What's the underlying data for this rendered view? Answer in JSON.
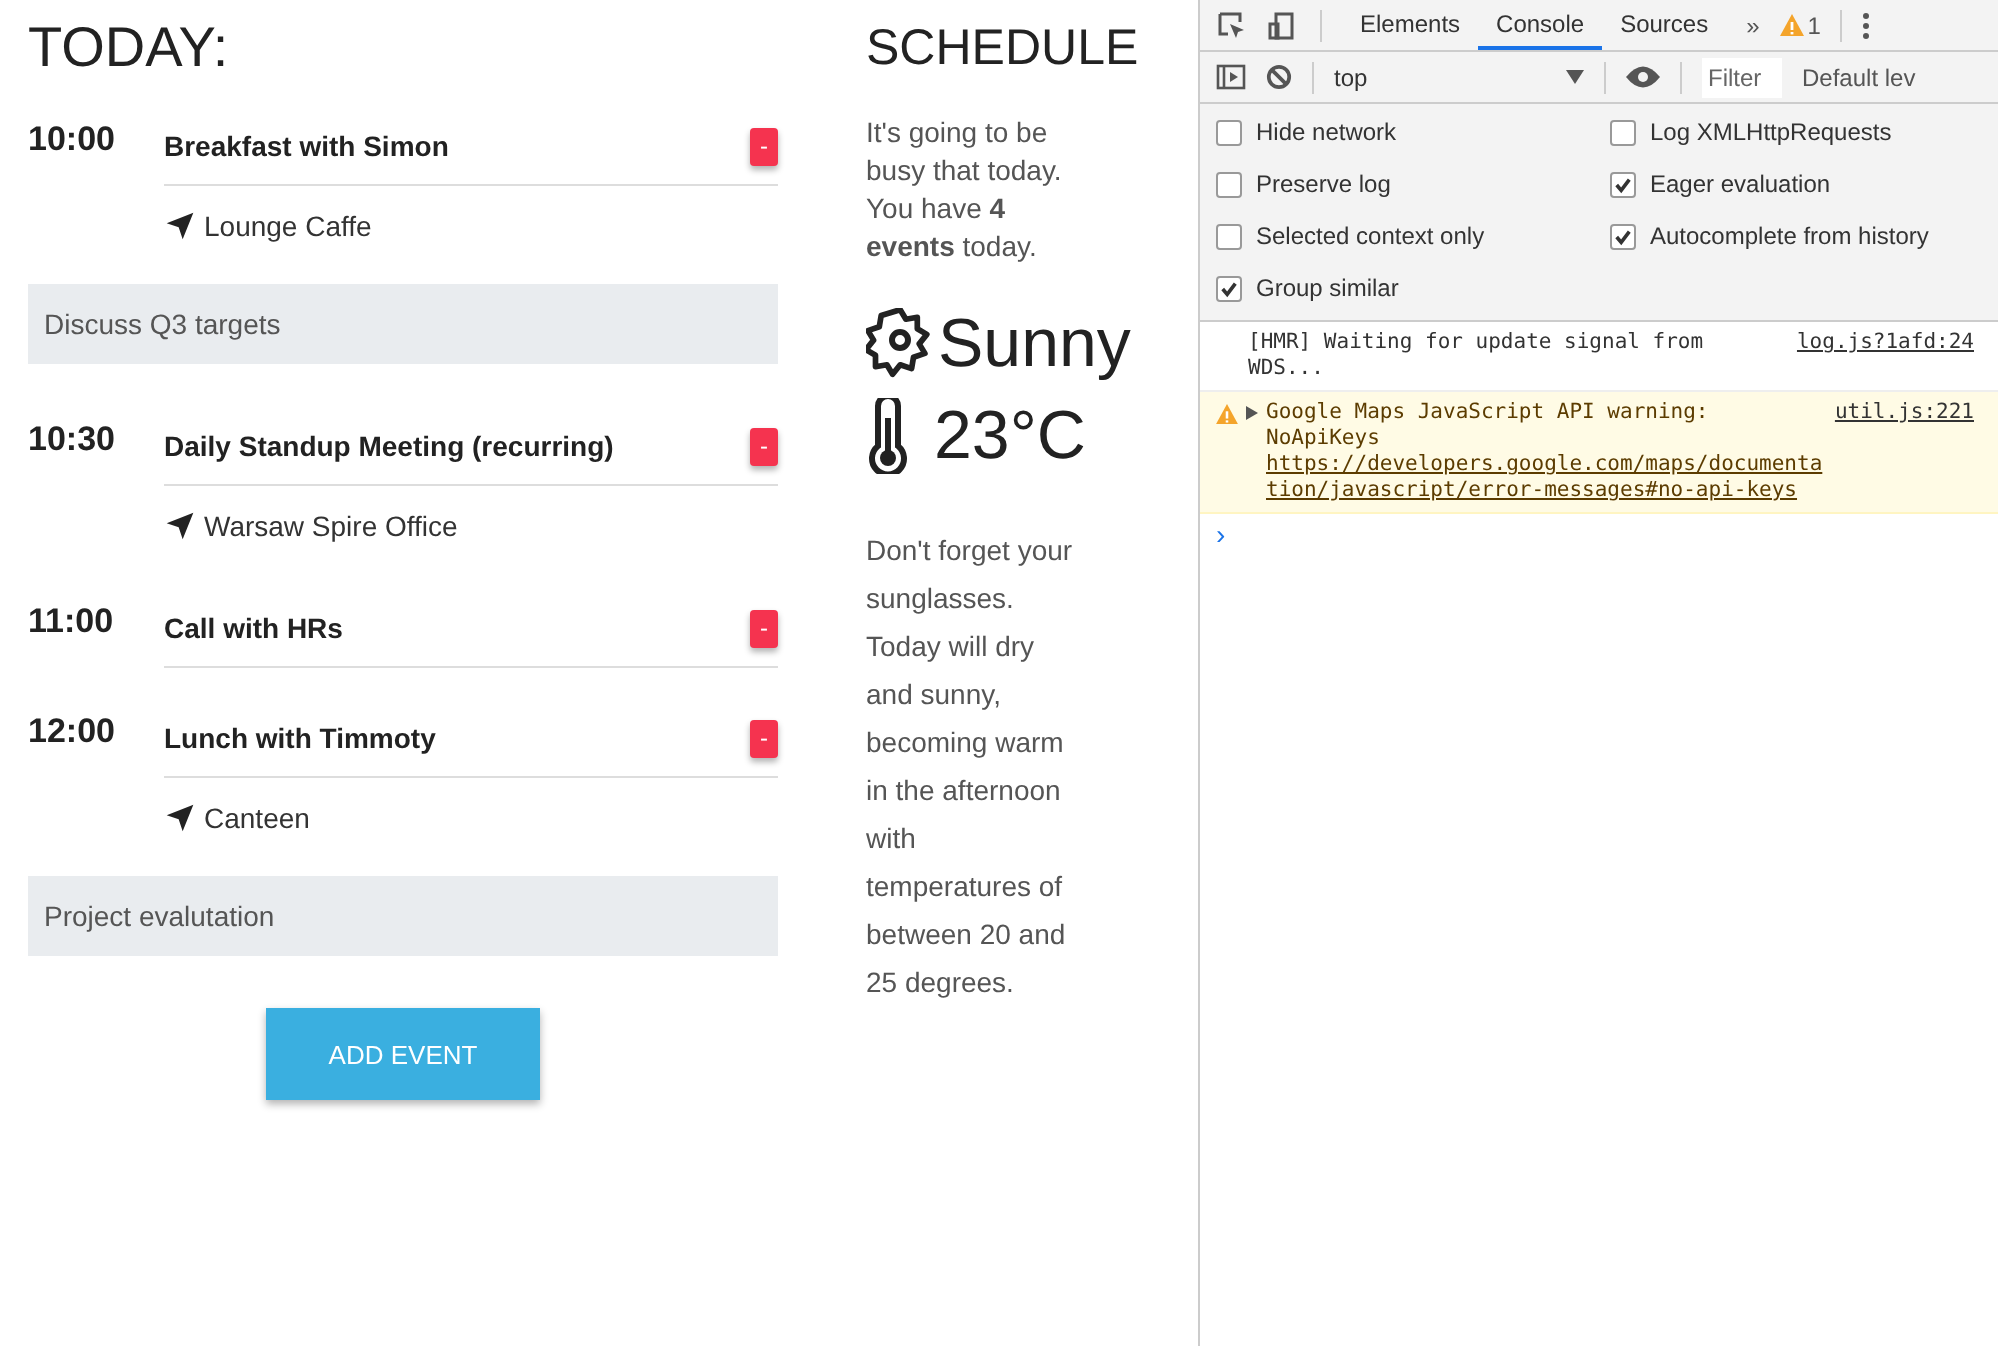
{
  "today": {
    "title": "TODAY:",
    "events": [
      {
        "time": "10:00",
        "title": "Breakfast with Simon",
        "remove": "-",
        "location": "Lounge Caffe",
        "note": "Discuss Q3 targets"
      },
      {
        "time": "10:30",
        "title": "Daily Standup Meeting (recurring)",
        "remove": "-",
        "location": "Warsaw Spire Office"
      },
      {
        "time": "11:00",
        "title": "Call with HRs",
        "remove": "-"
      },
      {
        "time": "12:00",
        "title": "Lunch with Timmoty",
        "remove": "-",
        "location": "Canteen",
        "note": "Project evalutation"
      }
    ],
    "add_button": "ADD EVENT"
  },
  "schedule": {
    "title": "SCHEDULE",
    "summary": "It's going to be busy that today. You have **4 events** today.",
    "weather": "Sunny",
    "temperature": "23°C",
    "advice": "Don't forget your sunglasses. Today will dry and sunny, becoming warm in the afternoon with temperatures of between 20 and 25 degrees."
  },
  "devtools": {
    "tabs": [
      {
        "label": "Elements",
        "selected": false
      },
      {
        "label": "Console",
        "selected": true
      },
      {
        "label": "Sources",
        "selected": false
      }
    ],
    "more": "»",
    "warnings": "1",
    "context": "top",
    "filter": {
      "placeholder": "Filter"
    },
    "levels": "Default lev",
    "settings": [
      {
        "label": "Hide network",
        "checked": false
      },
      {
        "label": "Log XMLHttpRequests",
        "checked": false
      },
      {
        "label": "Preserve log",
        "checked": false
      },
      {
        "label": "Eager evaluation",
        "checked": true
      },
      {
        "label": "Selected context only",
        "checked": false
      },
      {
        "label": "Autocomplete from history",
        "checked": true
      },
      {
        "label": "Group similar",
        "checked": true
      }
    ],
    "messages": [
      {
        "kind": "log",
        "text": "[HMR] Waiting for update signal from WDS...",
        "source": "log.js?1afd:24"
      },
      {
        "kind": "warning",
        "text": "Google Maps JavaScript API warning: NoApiKeys",
        "link": "https://developers.google.com/maps/documentation/javascript/error-messages#no-api-keys",
        "source": "util.js:221"
      }
    ],
    "prompt": "›"
  }
}
